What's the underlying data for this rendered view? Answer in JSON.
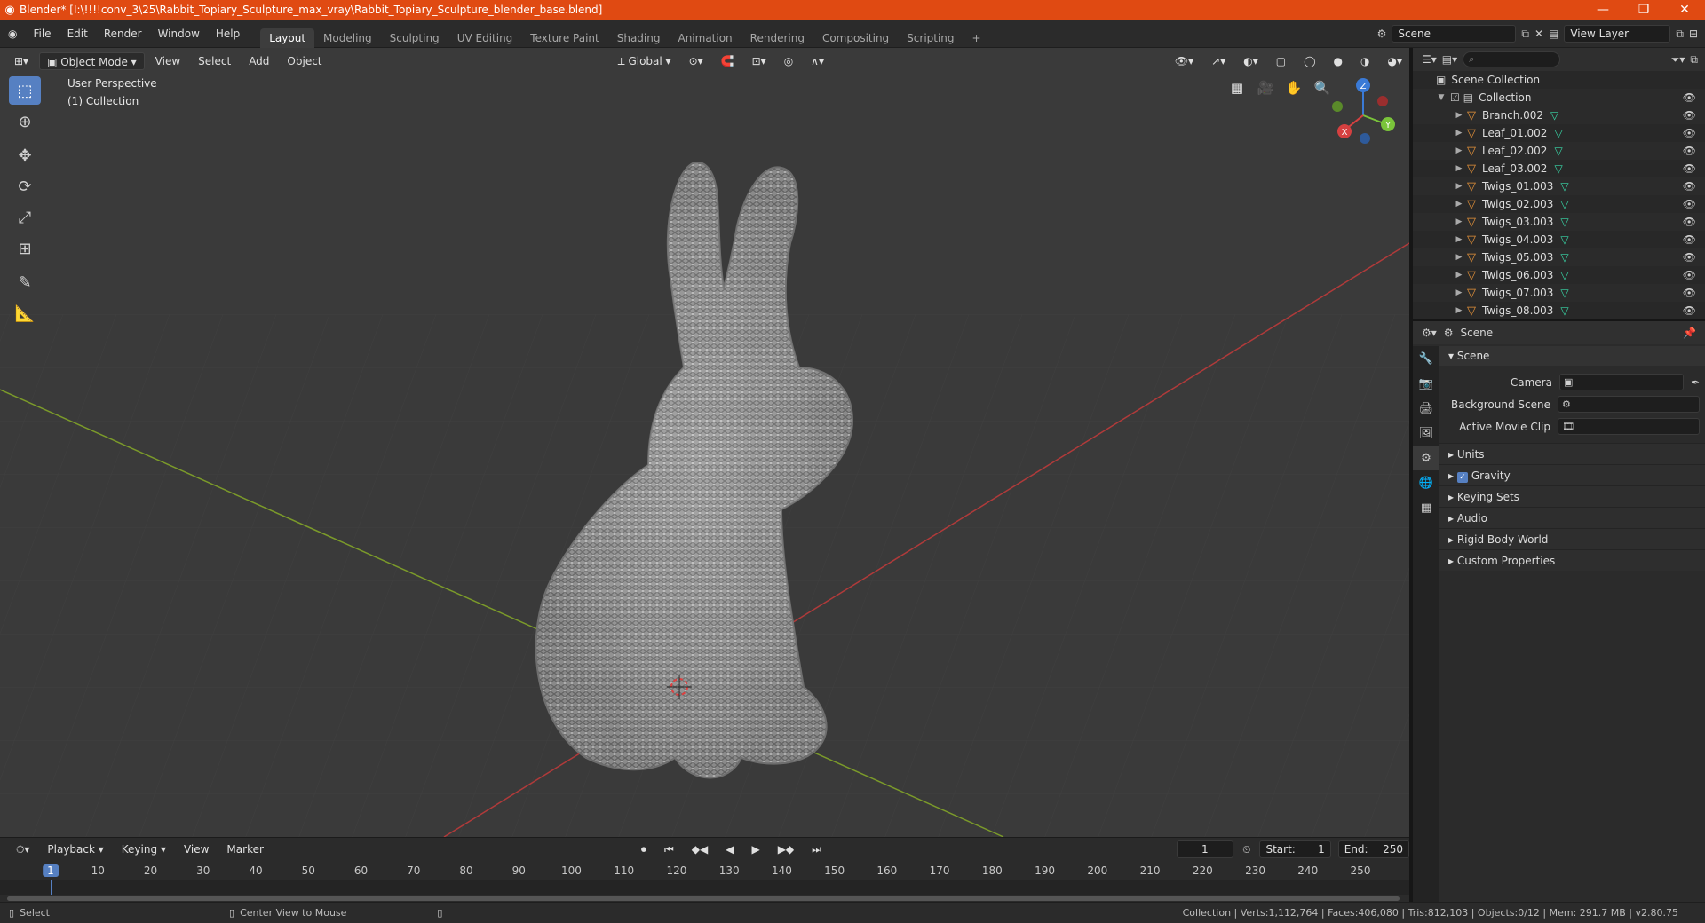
{
  "window": {
    "title": "Blender* [I:\\!!!!conv_3\\25\\Rabbit_Topiary_Sculpture_max_vray\\Rabbit_Topiary_Sculpture_blender_base.blend]",
    "minimize": "—",
    "maximize": "❐",
    "close": "✕"
  },
  "menu": [
    "File",
    "Edit",
    "Render",
    "Window",
    "Help"
  ],
  "workspaces": [
    "Layout",
    "Modeling",
    "Sculpting",
    "UV Editing",
    "Texture Paint",
    "Shading",
    "Animation",
    "Rendering",
    "Compositing",
    "Scripting"
  ],
  "workspace_add": "+",
  "scene_field": "Scene",
  "view_layer_field": "View Layer",
  "viewport": {
    "mode": "Object Mode",
    "menus": [
      "View",
      "Select",
      "Add",
      "Object"
    ],
    "orientation": "Global",
    "info_line1": "User Perspective",
    "info_line2": "(1) Collection",
    "gizmo_x": "X",
    "gizmo_y": "Y",
    "gizmo_z": "Z"
  },
  "outliner": {
    "root": "Scene Collection",
    "collection": "Collection",
    "items": [
      "Branch.002",
      "Leaf_01.002",
      "Leaf_02.002",
      "Leaf_03.002",
      "Twigs_01.003",
      "Twigs_02.003",
      "Twigs_03.003",
      "Twigs_04.003",
      "Twigs_05.003",
      "Twigs_06.003",
      "Twigs_07.003",
      "Twigs_08.003"
    ]
  },
  "properties": {
    "header": "Scene",
    "panel": "Scene",
    "camera_label": "Camera",
    "background_label": "Background Scene",
    "movie_label": "Active Movie Clip",
    "sections": [
      "Units",
      "Gravity",
      "Keying Sets",
      "Audio",
      "Rigid Body World",
      "Custom Properties"
    ]
  },
  "timeline": {
    "menus": [
      "Playback",
      "Keying",
      "View",
      "Marker"
    ],
    "current_frame": "1",
    "start_label": "Start:",
    "start_value": "1",
    "end_label": "End:",
    "end_value": "250",
    "ticks": [
      "1",
      "10",
      "20",
      "30",
      "40",
      "50",
      "60",
      "70",
      "80",
      "90",
      "100",
      "110",
      "120",
      "130",
      "140",
      "150",
      "160",
      "170",
      "180",
      "190",
      "200",
      "210",
      "220",
      "230",
      "240",
      "250"
    ]
  },
  "status": {
    "select": "Select",
    "center": "Center View to Mouse",
    "stats": "Collection | Verts:1,112,764 | Faces:406,080 | Tris:812,103 | Objects:0/12 | Mem: 291.7 MB | v2.80.75"
  },
  "colors": {
    "accent": "#5680c2",
    "titlebar": "#e04a12",
    "object_icon": "#e8943a",
    "mesh_icon": "#39d8a8"
  }
}
